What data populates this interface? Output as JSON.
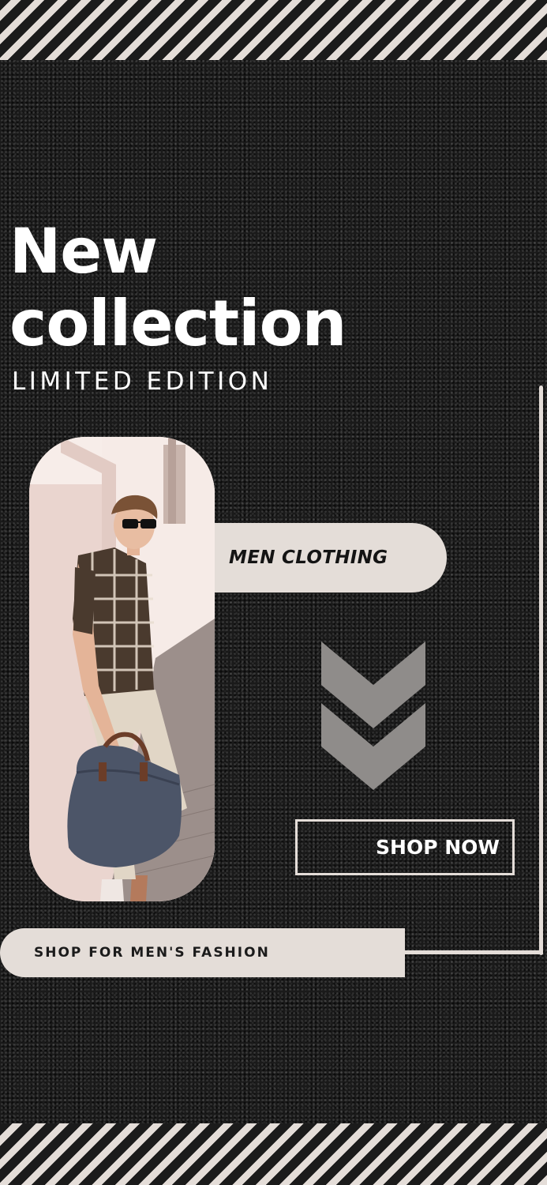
{
  "headline": {
    "line1": "New",
    "line2": "collection"
  },
  "subheadline": "LIMITED EDITION",
  "category_label": "MEN CLOTHING",
  "cta_button": "SHOP NOW",
  "footer_bar": "SHOP FOR MEN'S FASHION",
  "colors": {
    "background": "#1a1a1a",
    "accent": "#e4ddd8",
    "text_light": "#ffffff",
    "text_dark": "#141414",
    "chevron": "#8f8c8a"
  },
  "icons": {
    "chevrons": "double-chevron-down-icon"
  }
}
